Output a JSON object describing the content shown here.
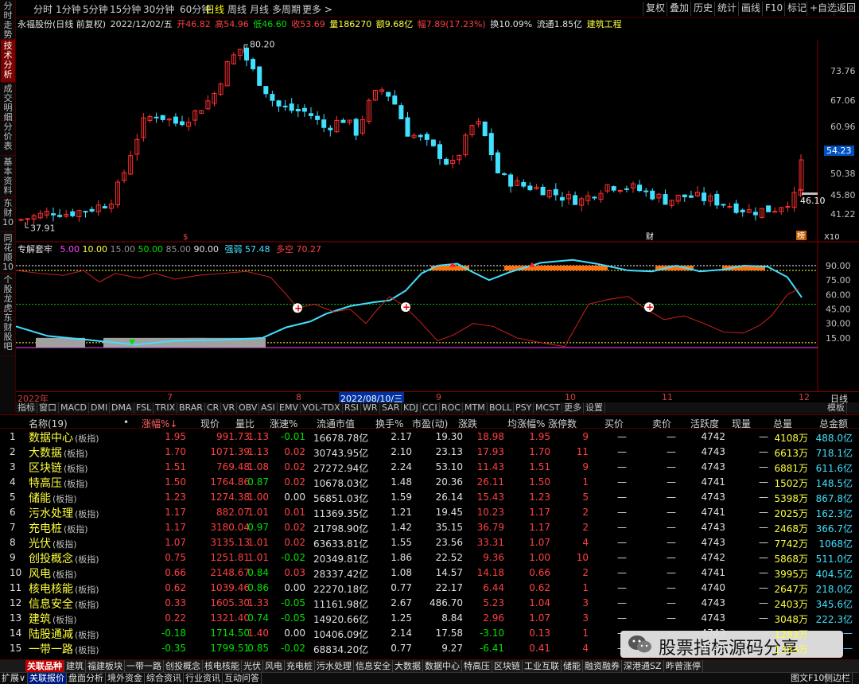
{
  "left_tabs": [
    "分时走势",
    "技术分析",
    "成交明细",
    "分价表",
    "基本资料",
    "东财10",
    "同花顺10",
    "个股龙虎",
    "东财股吧"
  ],
  "periods": [
    "分时",
    "1分钟",
    "5分钟",
    "15分钟",
    "30分钟",
    "60分钟",
    "日线",
    "周线",
    "月线",
    "多周期",
    "更多 >"
  ],
  "right_buttons": [
    "复权",
    "叠加",
    "历史",
    "统计",
    "画线",
    "F10",
    "标记",
    "+自选",
    "返回"
  ],
  "stock": {
    "name": "永福股份(日线 前复权)",
    "date": "2022/12/02/五",
    "open": "开46.82",
    "high": "高54.96",
    "low": "低46.60",
    "close": "收53.69",
    "volume": "量186270",
    "amount": "额9.68亿",
    "change": "幅7.89(17.23%)",
    "turnover": "换10.09%",
    "float": "流通1.85亿",
    "industry": "建筑工程"
  },
  "price_axis": [
    "73.76",
    "67.06",
    "60.96",
    "56.41",
    "54.23",
    "50.38",
    "45.80",
    "41.22"
  ],
  "annotations": {
    "high": "80.20",
    "low": "37.91",
    "last": "46.10",
    "x10": "X10",
    "s_mark": "$",
    "cai": "财",
    "hui": "榜"
  },
  "indicator": {
    "name": "专解套牢",
    "levels": [
      "5.00",
      "10.00",
      "15.00",
      "50.00",
      "85.00",
      "90.00"
    ],
    "strong_label": "强弱",
    "strong": "57.48",
    "multi_label": "多空",
    "multi": "70.27",
    "axis": [
      "90.00",
      "75.00",
      "60.00",
      "45.00",
      "30.00",
      "15.00"
    ]
  },
  "dates": [
    "2022年",
    "7",
    "8",
    "2022/08/10/三",
    "9",
    "10",
    "11",
    "12"
  ],
  "date_right": "日线",
  "indicator_tabs": [
    "指标",
    "窗口",
    "MACD",
    "DMI",
    "DMA",
    "FSL",
    "TRIX",
    "BRAR",
    "CR",
    "VR",
    "OBV",
    "ASI",
    "EMV",
    "VOL-TDX",
    "RSI",
    "WR",
    "SAR",
    "KDJ",
    "CCI",
    "ROC",
    "MTM",
    "BOLL",
    "PSY",
    "MCST",
    "更多",
    "设置"
  ],
  "template_btn": "模板",
  "columns": [
    "",
    "名称(19)",
    "•",
    "涨幅%↓",
    "现价",
    "量比",
    "涨速%",
    "流通市值",
    "换手%",
    "市盈(动)",
    "涨跌",
    "均涨幅%",
    "涨停数",
    "买价",
    "卖价",
    "活跃度",
    "现量",
    "总量",
    "总金额"
  ],
  "rows": [
    [
      "1",
      "数据中心",
      "1.95",
      "991.73",
      "1.13",
      "-0.01",
      "16678.78亿",
      "2.17",
      "19.30",
      "18.98",
      "1.95",
      "9",
      "—",
      "—",
      "4742",
      "—",
      "4108万",
      "488.0亿"
    ],
    [
      "2",
      "大数据",
      "1.70",
      "1071.39",
      "1.13",
      "0.02",
      "30743.95亿",
      "2.10",
      "23.13",
      "17.93",
      "1.70",
      "11",
      "—",
      "—",
      "4743",
      "—",
      "6613万",
      "718.1亿"
    ],
    [
      "3",
      "区块链",
      "1.51",
      "769.48",
      "1.08",
      "0.02",
      "27272.94亿",
      "2.24",
      "53.10",
      "11.43",
      "1.51",
      "9",
      "—",
      "—",
      "4743",
      "—",
      "6881万",
      "611.6亿"
    ],
    [
      "4",
      "特高压",
      "1.50",
      "1764.86",
      "0.87",
      "0.02",
      "10678.03亿",
      "1.48",
      "20.36",
      "26.11",
      "1.50",
      "1",
      "—",
      "—",
      "4741",
      "—",
      "1502万",
      "148.5亿"
    ],
    [
      "5",
      "储能",
      "1.23",
      "1274.38",
      "1.00",
      "0.00",
      "56851.03亿",
      "1.59",
      "26.14",
      "15.43",
      "1.23",
      "5",
      "—",
      "—",
      "4743",
      "—",
      "5398万",
      "867.8亿"
    ],
    [
      "6",
      "污水处理",
      "1.17",
      "882.07",
      "1.01",
      "0.01",
      "11369.35亿",
      "1.21",
      "19.45",
      "10.23",
      "1.17",
      "2",
      "—",
      "—",
      "4741",
      "—",
      "2025万",
      "162.3亿"
    ],
    [
      "7",
      "充电桩",
      "1.17",
      "3180.04",
      "0.97",
      "0.02",
      "21798.90亿",
      "1.42",
      "35.15",
      "36.79",
      "1.17",
      "2",
      "—",
      "—",
      "4743",
      "—",
      "2468万",
      "366.7亿"
    ],
    [
      "8",
      "光伏",
      "1.07",
      "3135.13",
      "1.01",
      "0.02",
      "63633.81亿",
      "1.55",
      "23.56",
      "33.31",
      "1.07",
      "4",
      "—",
      "—",
      "4743",
      "—",
      "7742万",
      "1068亿"
    ],
    [
      "9",
      "创投概念",
      "0.75",
      "1251.81",
      "1.01",
      "-0.02",
      "20349.81亿",
      "1.86",
      "22.52",
      "9.36",
      "1.00",
      "10",
      "—",
      "—",
      "4742",
      "—",
      "5868万",
      "511.0亿"
    ],
    [
      "10",
      "风电",
      "0.66",
      "2148.67",
      "0.84",
      "0.03",
      "28337.42亿",
      "1.08",
      "14.57",
      "14.18",
      "0.66",
      "2",
      "—",
      "—",
      "4741",
      "—",
      "3995万",
      "404.5亿"
    ],
    [
      "11",
      "核电核能",
      "0.62",
      "1039.46",
      "0.86",
      "0.00",
      "22270.18亿",
      "0.77",
      "22.17",
      "6.44",
      "0.62",
      "1",
      "—",
      "—",
      "4740",
      "—",
      "2647万",
      "218.0亿"
    ],
    [
      "12",
      "信息安全",
      "0.33",
      "1605.30",
      "1.33",
      "-0.05",
      "11161.98亿",
      "2.67",
      "486.70",
      "5.23",
      "1.04",
      "3",
      "—",
      "—",
      "4743",
      "—",
      "2403万",
      "345.6亿"
    ],
    [
      "13",
      "建筑",
      "0.22",
      "1321.40",
      "0.74",
      "-0.05",
      "14920.66亿",
      "1.25",
      "8.84",
      "2.96",
      "1.07",
      "3",
      "—",
      "—",
      "4743",
      "—",
      "3048万",
      "222.3亿"
    ],
    [
      "14",
      "陆股通减",
      "-0.18",
      "1714.50",
      "1.40",
      "0.00",
      "10406.09亿",
      "2.14",
      "17.58",
      "-3.10",
      "0.13",
      "1",
      "—",
      "—",
      "4743",
      "—",
      "1283万",
      "—"
    ],
    [
      "15",
      "一带一路",
      "-0.35",
      "1799.51",
      "0.85",
      "-0.02",
      "68834.20亿",
      "0.77",
      "9.27",
      "-6.41",
      "0.41",
      "4",
      "—",
      "—",
      "4743",
      "—",
      "1383万",
      "—"
    ]
  ],
  "row_suffix": "(板指)",
  "bottom_tabs": [
    "关联品种",
    "建筑",
    "福建板块",
    "一带一路",
    "创投概念",
    "核电核能",
    "光伏",
    "风电",
    "充电桩",
    "污水处理",
    "信息安全",
    "大数据",
    "数据中心",
    "特高压",
    "区块链",
    "工业互联",
    "储能",
    "融资融券",
    "深港通SZ",
    "昨曾涨停"
  ],
  "bottom2": [
    "扩展∨",
    "关联报价",
    "盘面分析",
    "境外资金",
    "综合资讯",
    "行业资讯",
    "互动问答"
  ],
  "bottom2_right": [
    "图文F10",
    "侧边栏"
  ],
  "watermark": "股票指标源码分享"
}
